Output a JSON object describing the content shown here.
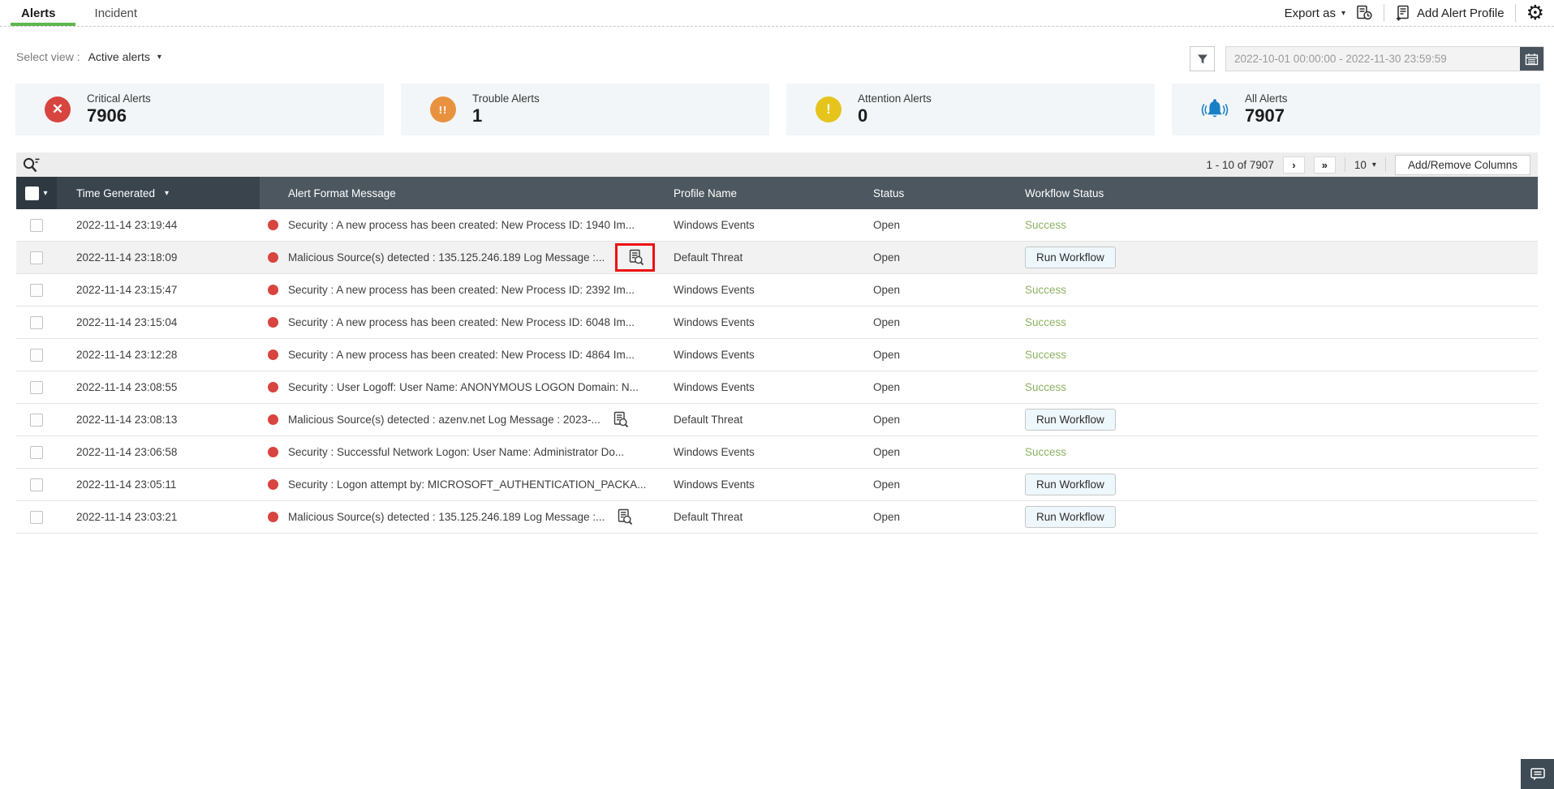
{
  "tabs": {
    "alerts": "Alerts",
    "incident": "Incident"
  },
  "topbar": {
    "export_label": "Export as",
    "add_alert_profile_label": "Add Alert Profile"
  },
  "view_selector": {
    "label": "Select view :",
    "selected": "Active alerts"
  },
  "date_filter": {
    "range": "2022-10-01 00:00:00 - 2022-11-30 23:59:59"
  },
  "summary_cards": [
    {
      "label": "Critical Alerts",
      "value": "7906",
      "icon": "critical-x-circle-icon",
      "color": "#d8443e",
      "glyph": "✕"
    },
    {
      "label": "Trouble Alerts",
      "value": "1",
      "icon": "trouble-double-exclamation-icon",
      "color": "#e89240",
      "glyph": "!!"
    },
    {
      "label": "Attention Alerts",
      "value": "0",
      "icon": "attention-exclamation-icon",
      "color": "#e5c41c",
      "glyph": "!"
    },
    {
      "label": "All Alerts",
      "value": "7907",
      "icon": "bell-icon",
      "color": "#1a7fc4",
      "glyph": ""
    }
  ],
  "toolbar": {
    "pagination_range": "1 - 10 of 7907",
    "next_page": "›",
    "last_page": "»",
    "page_size": "10",
    "add_remove_columns_label": "Add/Remove Columns"
  },
  "table": {
    "headers": {
      "time": "Time Generated",
      "message": "Alert Format Message",
      "profile": "Profile Name",
      "status": "Status",
      "workflow": "Workflow Status"
    },
    "rows": [
      {
        "time": "2022-11-14 23:19:44",
        "message": "Security : A new process has been created: New Process ID: 1940 Im...",
        "log_icon": false,
        "highlighted": false,
        "shaded": false,
        "profile": "Windows Events",
        "status": "Open",
        "workflow": {
          "type": "success",
          "label": "Success"
        }
      },
      {
        "time": "2022-11-14 23:18:09",
        "message": "Malicious Source(s) detected : 135.125.246.189 Log Message :...",
        "log_icon": true,
        "highlighted": true,
        "shaded": true,
        "profile": "Default Threat",
        "status": "Open",
        "workflow": {
          "type": "button",
          "label": "Run Workflow"
        }
      },
      {
        "time": "2022-11-14 23:15:47",
        "message": "Security : A new process has been created: New Process ID: 2392 Im...",
        "log_icon": false,
        "highlighted": false,
        "shaded": false,
        "profile": "Windows Events",
        "status": "Open",
        "workflow": {
          "type": "success",
          "label": "Success"
        }
      },
      {
        "time": "2022-11-14 23:15:04",
        "message": "Security : A new process has been created: New Process ID: 6048 Im...",
        "log_icon": false,
        "highlighted": false,
        "shaded": false,
        "profile": "Windows Events",
        "status": "Open",
        "workflow": {
          "type": "success",
          "label": "Success"
        }
      },
      {
        "time": "2022-11-14 23:12:28",
        "message": "Security : A new process has been created: New Process ID: 4864 Im...",
        "log_icon": false,
        "highlighted": false,
        "shaded": false,
        "profile": "Windows Events",
        "status": "Open",
        "workflow": {
          "type": "success",
          "label": "Success"
        }
      },
      {
        "time": "2022-11-14 23:08:55",
        "message": "Security : User Logoff: User Name: ANONYMOUS LOGON Domain: N...",
        "log_icon": false,
        "highlighted": false,
        "shaded": false,
        "profile": "Windows Events",
        "status": "Open",
        "workflow": {
          "type": "success",
          "label": "Success"
        }
      },
      {
        "time": "2022-11-14 23:08:13",
        "message": "Malicious Source(s) detected : azenv.net Log Message : 2023-...",
        "log_icon": true,
        "highlighted": false,
        "shaded": false,
        "profile": "Default Threat",
        "status": "Open",
        "workflow": {
          "type": "button",
          "label": "Run Workflow"
        }
      },
      {
        "time": "2022-11-14 23:06:58",
        "message": "Security : Successful Network Logon: User Name: Administrator Do...",
        "log_icon": false,
        "highlighted": false,
        "shaded": false,
        "profile": "Windows Events",
        "status": "Open",
        "workflow": {
          "type": "success",
          "label": "Success"
        }
      },
      {
        "time": "2022-11-14 23:05:11",
        "message": "Security : Logon attempt by: MICROSOFT_AUTHENTICATION_PACKA...",
        "log_icon": false,
        "highlighted": false,
        "shaded": false,
        "profile": "Windows Events",
        "status": "Open",
        "workflow": {
          "type": "button",
          "label": "Run Workflow"
        }
      },
      {
        "time": "2022-11-14 23:03:21",
        "message": "Malicious Source(s) detected : 135.125.246.189 Log Message :...",
        "log_icon": true,
        "highlighted": false,
        "shaded": false,
        "profile": "Default Threat",
        "status": "Open",
        "workflow": {
          "type": "button",
          "label": "Run Workflow"
        }
      }
    ]
  },
  "colors": {
    "tab_accent_green": "#5eb84d",
    "critical_red": "#d8443e",
    "trouble_orange": "#e89240",
    "attention_yellow": "#e5c41c",
    "all_alerts_blue": "#1a7fc4",
    "success_green": "#8cb263",
    "header_dark": "#4d575f",
    "header_darker": "#2e3841",
    "annotation_red": "#ee1111"
  }
}
